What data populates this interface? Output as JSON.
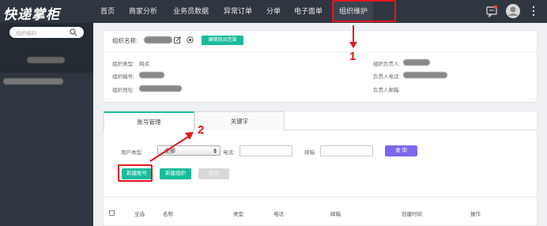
{
  "app": {
    "logo": "快递掌柜"
  },
  "nav": [
    {
      "label": "首页"
    },
    {
      "label": "商家分析"
    },
    {
      "label": "业务员数据"
    },
    {
      "label": "异常订单"
    },
    {
      "label": "分单"
    },
    {
      "label": "电子面单"
    },
    {
      "label": "组织维护",
      "active": true
    }
  ],
  "sidebar": {
    "search_placeholder": "组织编码"
  },
  "org": {
    "name_label": "组织名称:",
    "edit_scope_button": "编辑揽派范围",
    "type_label": "组织类型:",
    "type_value": "网点",
    "code_label": "组织编号:",
    "address_label": "组织地址:",
    "manager_label": "组织负责人:",
    "phone_label": "负责人电话:",
    "email_label": "负责人邮箱:"
  },
  "tabs": [
    {
      "label": "账号管理",
      "active": true
    },
    {
      "label": "关键字"
    }
  ],
  "filter": {
    "user_type_label": "用户类型:",
    "user_type_value": "全部",
    "phone_label": "电话:",
    "email_label": "邮箱:",
    "query_button": "查 询"
  },
  "actions": {
    "new_account": "新建账号",
    "new_org": "新建组织",
    "delete": "删除"
  },
  "table": {
    "headers": [
      "全选",
      "名称",
      "类型",
      "电话",
      "邮箱",
      "创建时间",
      "操作"
    ]
  },
  "annotations": {
    "step1": "1",
    "step2": "2"
  },
  "colors": {
    "accent": "#1abc9c",
    "highlight": "#e3161f",
    "query": "#7b68ee",
    "topbar": "#2f3640"
  }
}
